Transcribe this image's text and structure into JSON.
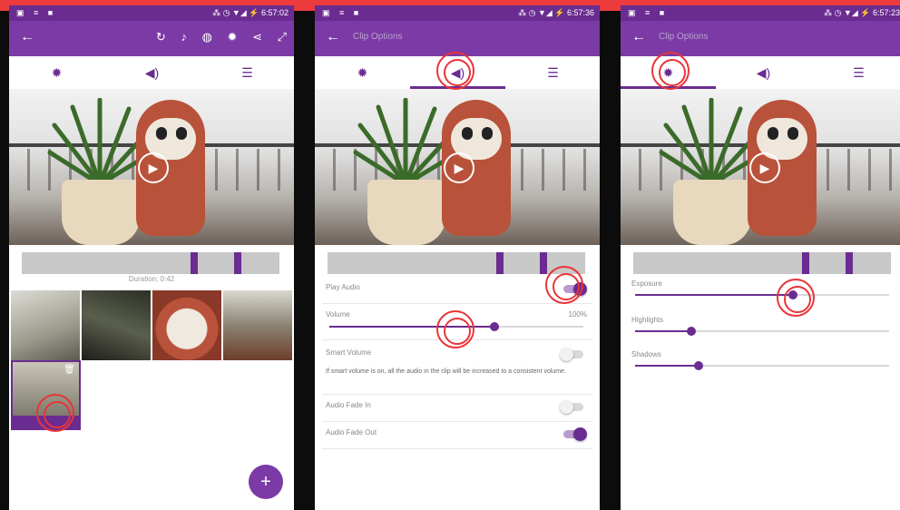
{
  "colors": {
    "accent": "#6a2c91",
    "appbar": "#7b3aa5",
    "annotation": "#e8353a",
    "banner": "#ed3a3c"
  },
  "status_time_1": "6:57:02",
  "status_time_2": "6:57:36",
  "status_time_3": "6:57:23",
  "screen1": {
    "toolbar_icons": [
      "refresh-icon",
      "music-note-icon",
      "palette-icon",
      "gear-icon",
      "share-icon",
      "fullscreen-icon"
    ],
    "tabs": [
      "settings-icon",
      "volume-icon",
      "adjust-icon"
    ],
    "duration": "Duration: 0:42",
    "fab": "+",
    "selected_tab": 0
  },
  "screen2": {
    "title": "Clip Options",
    "selected_tab": 1,
    "play_audio_label": "Play Audio",
    "play_audio_on": true,
    "volume_label": "Volume",
    "volume_value": "100%",
    "volume_level": 0.65,
    "smart_volume_label": "Smart Volume",
    "smart_volume_on": false,
    "smart_volume_desc": "If smart volume is on, all the audio in the clip will be increased to a consistent volume.",
    "fade_in_label": "Audio Fade In",
    "fade_in_on": false,
    "fade_out_label": "Audio Fade Out",
    "fade_out_on": true
  },
  "screen3": {
    "title": "Clip Options",
    "selected_tab": 0,
    "exposure_label": "Exposure",
    "exposure_level": 0.62,
    "highlights_label": "Highlights",
    "highlights_level": 0.22,
    "shadows_label": "Shadows",
    "shadows_level": 0.25
  }
}
